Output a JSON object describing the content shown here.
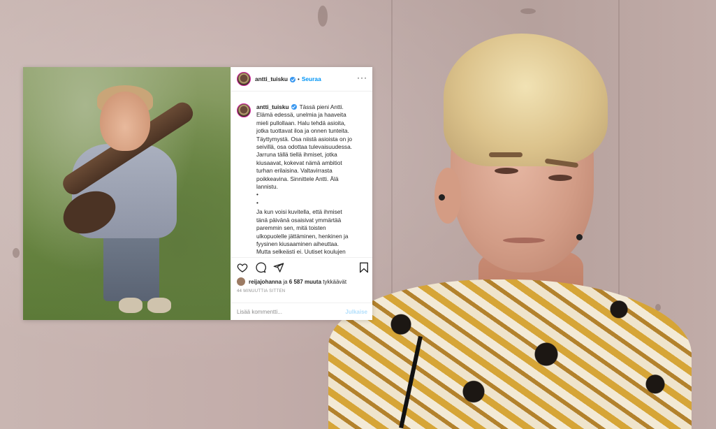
{
  "post": {
    "username": "antti_tuisku",
    "follow_label": "Seuraa",
    "separator": "•",
    "more_icon": "more-horizontal-icon",
    "caption_user": "antti_tuisku",
    "caption_lines": [
      "Tässä pieni Antti.",
      "Elämä edessä, unelmia ja haaveita",
      "mieli pullollaan. Halu tehdä asioita,",
      "jotka tuottavat iloa ja onnen tunteita.",
      "Täyttymystä. Osa niistä asioista on jo",
      "seivillä, osa odottaa tulevaisuudessa.",
      "Jarruna tällä tiellä ihmiset, jotka",
      "kiusaavat, kokevat nämä ambitiot",
      "turhan erilaisina. Valtavirrasta",
      "poikkeavina. Sinnittele Antti. Älä",
      "lannistu.",
      "•",
      "•",
      "Ja kun voisi kuvitella, että ihmiset",
      "tänä päivänä osaisivat ymmärtää",
      "paremmin sen, mitä toisten",
      "ulkopuolelle jättäminen, henkinen ja",
      "fyysinen kiusaaminen aiheuttaa.",
      "Mutta selkeästi ei. Uutiset koulujen"
    ],
    "likes_user": "reijajohanna",
    "likes_mid": " ja ",
    "likes_count": "6 587 muuta",
    "likes_suffix": " tykkäävät",
    "timestamp": "44 MINUUTTIA SITTEN",
    "comment_placeholder": "Lisää kommentti...",
    "post_button": "Julkaise",
    "colors": {
      "link": "#0095f6",
      "verified": "#3897f0",
      "post_disabled": "#b2dffc"
    }
  }
}
